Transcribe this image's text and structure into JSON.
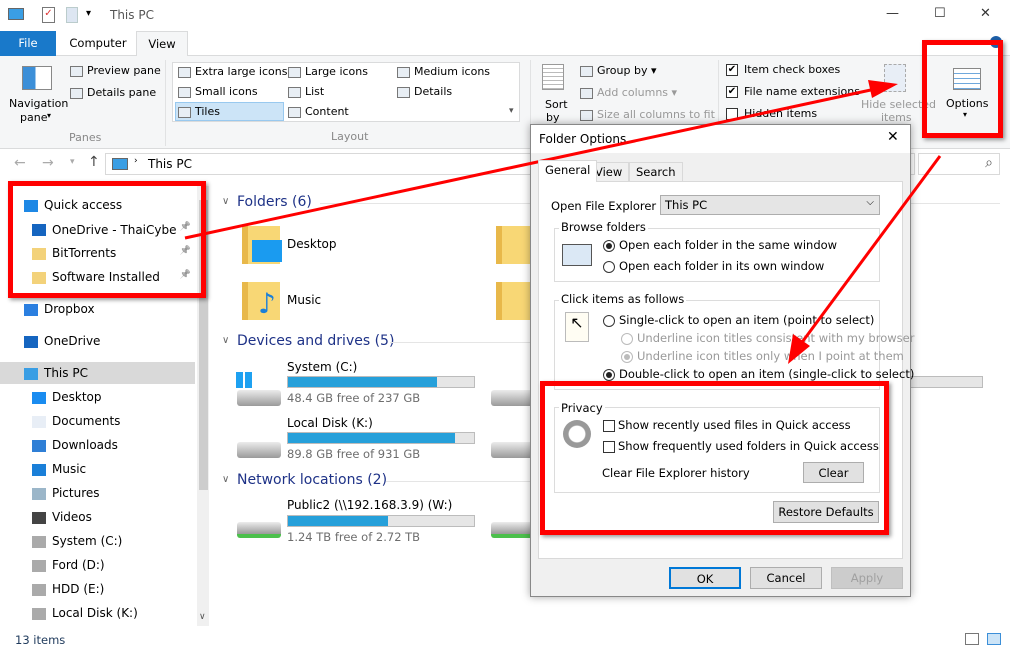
{
  "window": {
    "title": "This PC",
    "minimize": "—",
    "maximize": "☐",
    "close": "✕"
  },
  "tabs": [
    {
      "label": "File"
    },
    {
      "label": "Computer"
    },
    {
      "label": "View"
    }
  ],
  "ribbon": {
    "panes": {
      "navigation_pane": "Navigation",
      "navigation_pane2": "pane",
      "preview_pane": "Preview pane",
      "details_pane": "Details pane",
      "group": "Panes"
    },
    "layout": {
      "items": [
        "Extra large icons",
        "Large icons",
        "Medium icons",
        "Small icons",
        "List",
        "Details",
        "Tiles",
        "Content"
      ],
      "selected": "Tiles",
      "group": "Layout"
    },
    "current_view": {
      "sort_by": "Sort",
      "sort_by2": "by",
      "group_by": "Group by",
      "add_columns": "Add columns",
      "size_columns": "Size all columns to fit"
    },
    "show_hide": {
      "item_check_boxes": "Item check boxes",
      "item_check_boxes_checked": true,
      "file_name_extensions": "File name extensions",
      "file_name_extensions_checked": true,
      "hidden_items": "Hidden items",
      "hidden_items_checked": false,
      "hide_selected": "Hide selected",
      "hide_selected2": "items"
    },
    "options": "Options"
  },
  "address": {
    "path": "This PC",
    "back": "←",
    "forward": "→",
    "up": "↑",
    "search_icon": "⌕"
  },
  "nav": {
    "items": [
      {
        "label": "Quick access",
        "icon": "star-icon"
      },
      {
        "label": "OneDrive - ThaiCyberPc",
        "icon": "onedrive-icon",
        "pinned": true
      },
      {
        "label": "BitTorrents",
        "icon": "folder-icon",
        "pinned": true
      },
      {
        "label": "Software Installed",
        "icon": "folder-icon",
        "pinned": true
      },
      {
        "label": "Dropbox",
        "icon": "dropbox-icon"
      },
      {
        "label": "OneDrive",
        "icon": "onedrive-icon"
      },
      {
        "label": "This PC",
        "icon": "computer-icon",
        "selected": true
      },
      {
        "label": "Desktop",
        "icon": "desktop-icon"
      },
      {
        "label": "Documents",
        "icon": "documents-icon"
      },
      {
        "label": "Downloads",
        "icon": "download-icon"
      },
      {
        "label": "Music",
        "icon": "music-icon"
      },
      {
        "label": "Pictures",
        "icon": "pictures-icon"
      },
      {
        "label": "Videos",
        "icon": "videos-icon"
      },
      {
        "label": "System (C:)",
        "icon": "drive-icon"
      },
      {
        "label": "Ford (D:)",
        "icon": "drive-icon"
      },
      {
        "label": "HDD (E:)",
        "icon": "drive-icon"
      },
      {
        "label": "Local Disk (K:)",
        "icon": "drive-icon"
      }
    ]
  },
  "content": {
    "folders_header": "Folders (6)",
    "folders": [
      {
        "label": "Desktop"
      },
      {
        "label": "Music"
      }
    ],
    "devices_header": "Devices and drives (5)",
    "drives": [
      {
        "label": "System (C:)",
        "free": "48.4 GB free of 237 GB",
        "used_pct": 80
      },
      {
        "label": "Local Disk (K:)",
        "free": "89.8 GB free of 931 GB",
        "used_pct": 90
      }
    ],
    "network_header": "Network locations (2)",
    "network": [
      {
        "label": "Public2 (\\\\192.168.3.9) (W:)",
        "free": "1.24 TB free of 2.72 TB",
        "used_pct": 54
      }
    ]
  },
  "status": {
    "items": "13 items"
  },
  "dialog": {
    "title": "Folder Options",
    "tabs": [
      "General",
      "View",
      "Search"
    ],
    "open_label": "Open File Explorer to:",
    "open_value": "This PC",
    "browse": {
      "legend": "Browse folders",
      "opt1": "Open each folder in the same window",
      "opt2": "Open each folder in its own window"
    },
    "click": {
      "legend": "Click items as follows",
      "single": "Single-click to open an item (point to select)",
      "underline1": "Underline icon titles consistent with my browser",
      "underline2": "Underline icon titles only when I point at them",
      "double": "Double-click to open an item (single-click to select)"
    },
    "privacy": {
      "legend": "Privacy",
      "recent": "Show recently used files in Quick access",
      "frequent": "Show frequently used folders in Quick access",
      "clear_label": "Clear File Explorer history",
      "clear": "Clear"
    },
    "restore": "Restore Defaults",
    "ok": "OK",
    "cancel": "Cancel",
    "apply": "Apply"
  },
  "colors": {
    "accent": "#1979ca",
    "annotation": "#ff0000",
    "progress": "#26a0da"
  }
}
